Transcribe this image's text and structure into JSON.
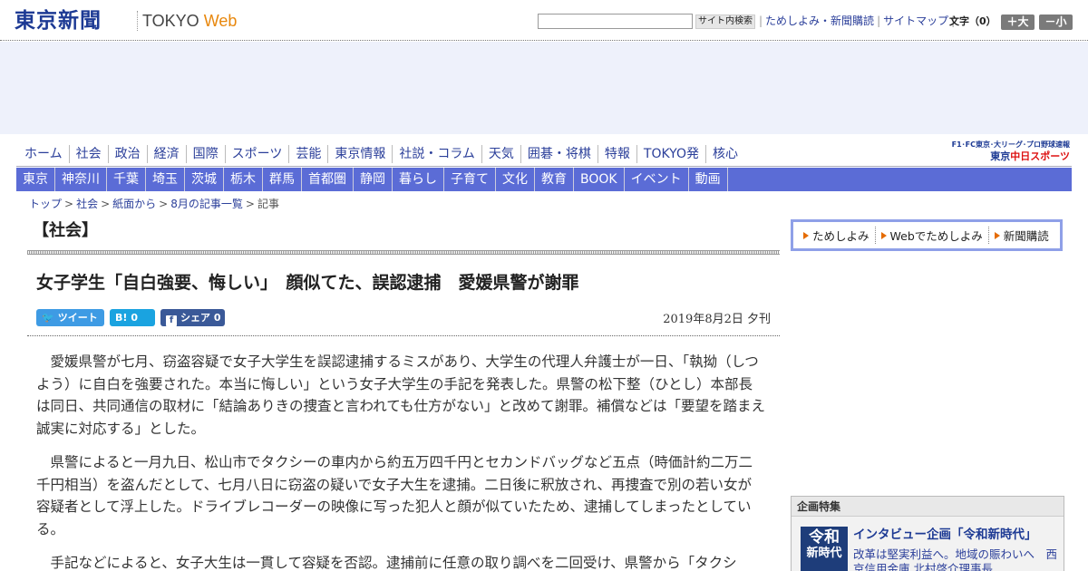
{
  "header": {
    "logo": "東京新聞",
    "logo_tokyo": "TOKYO",
    "logo_web": "Web",
    "search_placeholder": "",
    "search_button": "サイト内検索",
    "links": [
      "ためしよみ・新聞購読",
      "サイトマップ"
    ],
    "fontsize_label": "文字（0）",
    "fontsize_plus": "＋大",
    "fontsize_minus": "－小"
  },
  "global_nav": [
    "ホーム",
    "社会",
    "政治",
    "経済",
    "国際",
    "スポーツ",
    "芸能",
    "東京情報",
    "社説・コラム",
    "天気",
    "囲碁・将棋",
    "特報",
    "TOKYO発",
    "核心"
  ],
  "chuspo": {
    "small": "F1･FC東京･大リーグ･プロ野球速報",
    "prefix": "東京",
    "name": "中日スポーツ"
  },
  "regional_nav": [
    "東京",
    "神奈川",
    "千葉",
    "埼玉",
    "茨城",
    "栃木",
    "群馬",
    "首都圏",
    "静岡",
    "暮らし",
    "子育て",
    "文化",
    "教育",
    "BOOK",
    "イベント",
    "動画"
  ],
  "breadcrumb": [
    "トップ",
    "社会",
    "紙面から",
    "8月の記事一覧",
    "記事"
  ],
  "article": {
    "section": "【社会】",
    "headline": "女子学生「自白強要、悔しい」　顔似てた、誤認逮捕　愛媛県警が謝罪",
    "date": "2019年8月2日 夕刊",
    "share": {
      "tweet": "ツイート",
      "hatena_icon": "B!",
      "hatena_count": "0",
      "fb_label": "シェア",
      "fb_count": "0"
    },
    "paragraphs": [
      "愛媛県警が七月、窃盗容疑で女子大学生を誤認逮捕するミスがあり、大学生の代理人弁護士が一日、「執拗（しつよう）に自白を強要された。本当に悔しい」という女子大学生の手記を発表した。県警の松下整（ひとし）本部長は同日、共同通信の取材に「結論ありきの捜査と言われても仕方がない」と改めて謝罪。補償などは「要望を踏まえ誠実に対応する」とした。",
      "県警によると一月九日、松山市でタクシーの車内から約五万四千円とセカンドバッグなど五点（時価計約二万二千円相当）を盗んだとして、七月八日に窃盗の疑いで女子大生を逮捕。二日後に釈放され、再捜査で別の若い女が容疑者として浮上した。ドライブレコーダーの映像に写った犯人と顔が似ていたため、逮捕してしまったとしている。",
      "手記などによると、女子大生は一貫して容疑を否認。逮捕前に任意の取り調べを二回受け、県警から「タクシ"
    ]
  },
  "sidebar": {
    "subscribe": [
      "ためしよみ",
      "Webでためしよみ",
      "新聞購読"
    ],
    "feature": {
      "title": "企画特集",
      "badge_line1": "令和",
      "badge_line2": "新時代",
      "headline": "インタビュー企画「令和新時代」",
      "sub": "改革は堅実利益へ。地域の賑わいへ　西京信用金庫 北村啓介理事長"
    }
  },
  "colors": {
    "brand": "#1d3a94",
    "regional_nav_bg": "#5b6cd6",
    "twitter": "#3e9be4",
    "hatena": "#1aa3e0",
    "facebook": "#3a5998"
  }
}
